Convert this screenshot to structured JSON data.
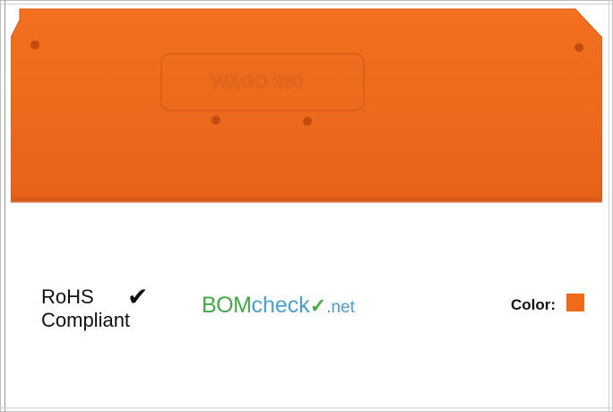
{
  "product": {
    "molded_text": "WAGO 280",
    "color_hex": "#ef6a1a"
  },
  "compliance": {
    "rohs_line1": "RoHS",
    "rohs_line2": "Compliant",
    "check_glyph": "✔",
    "check_icon": "check-icon"
  },
  "bomcheck": {
    "part1": "BOM",
    "part2": "check",
    "tick": "✓",
    "part3": ".net"
  },
  "color_info": {
    "label": "Color:",
    "swatch_hex": "#ef6a1a"
  }
}
